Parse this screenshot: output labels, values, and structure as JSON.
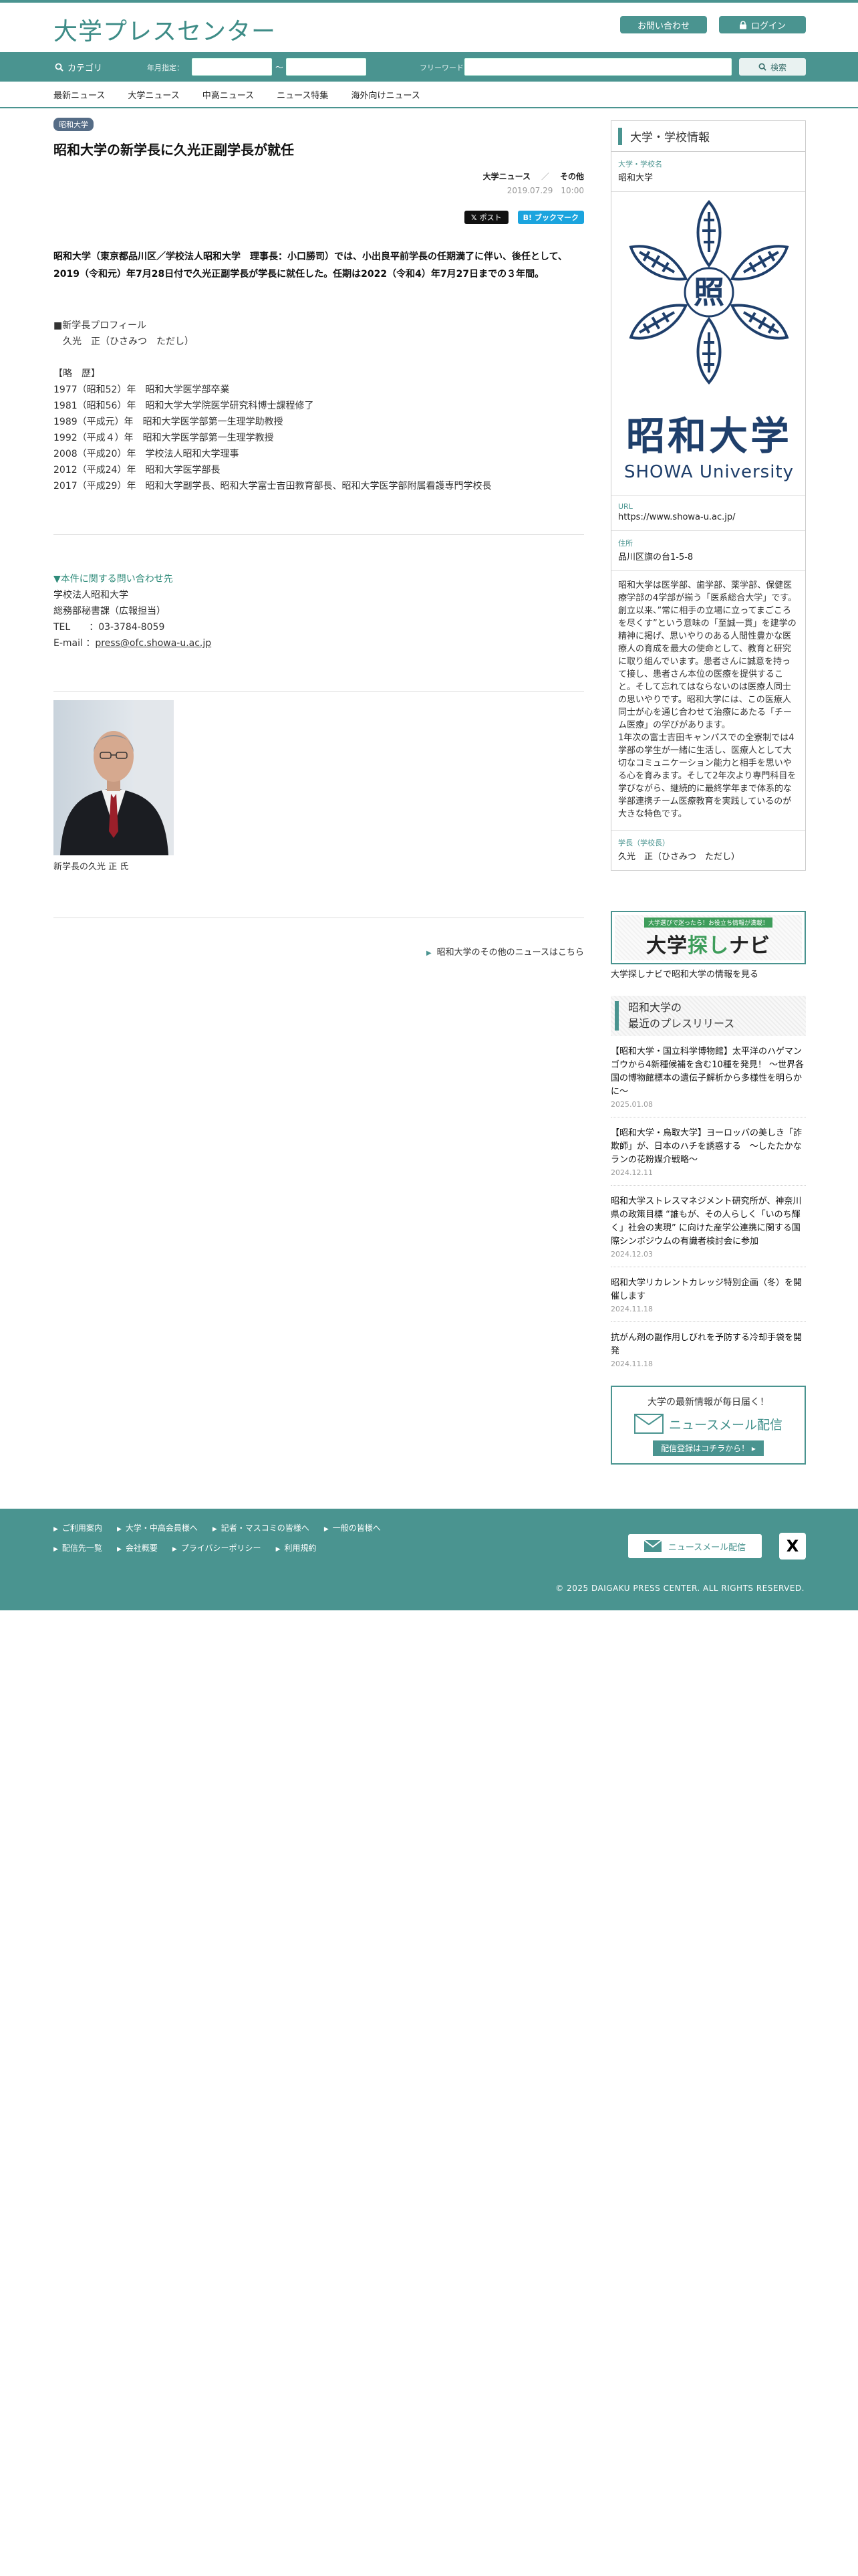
{
  "header": {
    "logo": "大学プレスセンター",
    "contact_label": "お問い合わせ",
    "login_label": "ログイン"
  },
  "search": {
    "category_label": "カテゴリ",
    "ym_label": "年月指定：",
    "tilde": "～",
    "freeword_label": "フリーワード：",
    "button_label": "検索"
  },
  "nav": [
    "最新ニュース",
    "大学ニュース",
    "中高ニュース",
    "ニュース特集",
    "海外向けニュース"
  ],
  "article": {
    "badge": "昭和大学",
    "title": "昭和大学の新学長に久光正副学長が就任",
    "category": "大学ニュース",
    "category_sep": "／",
    "subcategory": "その他",
    "date": "2019.07.29　10:00",
    "share_x": "ポスト",
    "share_hatena": "ブックマーク",
    "lead": "昭和大学（東京都品川区／学校法人昭和大学　理事長：小口勝司）では、小出良平前学長の任期満了に伴い、後任として、2019（令和元）年7月28日付で久光正副学長が学長に就任した。任期は2022（令和4）年7月27日までの３年間。",
    "profile": "■新学長プロフィール\n　久光　正（ひさみつ　ただし）\n\n【略　歴】\n1977（昭和52）年　昭和大学医学部卒業\n1981（昭和56）年　昭和大学大学院医学研究科博士課程修了\n1989（平成元）年　昭和大学医学部第一生理学助教授\n1992（平成４）年　昭和大学医学部第一生理学教授\n2008（平成20）年　学校法人昭和大学理事\n2012（平成24）年　昭和大学医学部長\n2017（平成29）年　昭和大学副学長、昭和大学富士吉田教育部長、昭和大学医学部附属看護専門学校長",
    "contact_heading": "▼本件に関する問い合わせ先",
    "contact_body": "学校法人昭和大学\n総務部秘書課（広報担当）\nTEL　　：03-3784-8059\nE-mail ：",
    "contact_email": "press@ofc.showa-u.ac.jp",
    "photo_caption": "新学長の久光 正 氏",
    "more_link": "昭和大学のその他のニュースはこちら"
  },
  "sidebar": {
    "heading": "大学・学校情報",
    "name_label": "大学・学校名",
    "name": "昭和大学",
    "logo_kanji": "昭和大学",
    "logo_roman": "SHOWA University",
    "url_label": "URL",
    "url": "https://www.showa-u.ac.jp/",
    "address_label": "住所",
    "address": "品川区旗の台1-5-8",
    "description": "昭和大学は医学部、歯学部、薬学部、保健医療学部の4学部が揃う「医系総合大学」です。創立以来、”常に相手の立場に立ってまごころを尽くす”という意味の「至誠一貫」を建学の精神に掲げ、思いやりのある人間性豊かな医療人の育成を最大の使命として、教育と研究に取り組んでいます。患者さんに誠意を持って接し、患者さん本位の医療を提供すること。そして忘れてはならないのは医療人同士の思いやりです。昭和大学には、この医療人同士が心を通じ合わせて治療にあたる「チーム医療」の学びがあります。\n1年次の富士吉田キャンパスでの全寮制では4学部の学生が一緒に生活し、医療人として大切なコミュニケーション能力と相手を思いやる心を育みます。そして2年次より専門科目を学びながら、継続的に最終学年まで体系的な学部連携チーム医療教育を実践しているのが大きな特色です。",
    "president_label": "学長（学校長）",
    "president": "久光　正（ひさみつ　ただし）",
    "navi_tag": "大学選びで迷ったら！お役立ち情報が満載！",
    "navi_title_a": "大学",
    "navi_title_b": "探し",
    "navi_title_c": "ナビ",
    "navi_caption": "大学探しナビで昭和大学の情報を見る",
    "press_heading_1": "昭和大学の",
    "press_heading_2": "最近のプレスリリース",
    "press": [
      {
        "title": "【昭和大学・国立科学博物館】太平洋のハゲマンゴウから4新種候補を含む10種を発見！ 〜世界各国の博物館標本の遺伝子解析から多様性を明らかに〜",
        "date": "2025.01.08"
      },
      {
        "title": "【昭和大学・鳥取大学】ヨーロッパの美しき「詐欺師」が、日本のハチを誘惑する　〜したたかなランの花粉媒介戦略〜",
        "date": "2024.12.11"
      },
      {
        "title": "昭和大学ストレスマネジメント研究所が、神奈川県の政策目標 “誰もが、その人らしく「いのち輝く」社会の実現” に向けた産学公連携に関する国際シンポジウムの有識者検討会に参加",
        "date": "2024.12.03"
      },
      {
        "title": "昭和大学リカレントカレッジ特別企画（冬）を開催します",
        "date": "2024.11.18"
      },
      {
        "title": "抗がん剤の副作用しびれを予防する冷却手袋を開発",
        "date": "2024.11.18"
      }
    ],
    "mail_t1": "大学の最新情報が毎日届く！",
    "mail_t2": "ニュースメール配信",
    "mail_t3": "配信登録はコチラから！ ▸"
  },
  "footer": {
    "row1": [
      "ご利用案内",
      "大学・中高会員様へ",
      "記者・マスコミの皆様へ",
      "一般の皆様へ"
    ],
    "row2": [
      "配信先一覧",
      "会社概要",
      "プライバシーポリシー",
      "利用規約"
    ],
    "mail_button": "ニュースメール配信",
    "x_label": "X",
    "copyright": "© 2025 DAIGAKU PRESS CENTER. ALL RIGHTS RESERVED."
  },
  "colors": {
    "brand": "#4a9490",
    "badge": "#556c86",
    "logo_navy": "#1f3f6b"
  }
}
